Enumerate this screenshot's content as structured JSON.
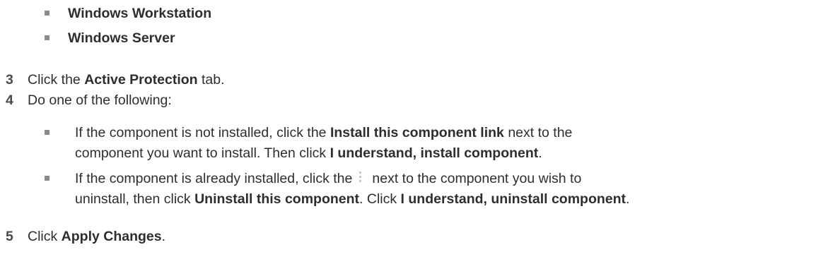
{
  "sub_items": [
    "Windows Workstation",
    "Windows Server"
  ],
  "steps": {
    "step3": {
      "number": "3",
      "pre": "Click the ",
      "bold": "Active Protection",
      "post": " tab."
    },
    "step4": {
      "number": "4",
      "text": "Do one of the following:",
      "options": {
        "a": {
          "line1_pre": "If the component is not installed, click the ",
          "line1_bold": "Install this component link",
          "line1_post": " next to the",
          "line2_pre": "component you want to install. Then click ",
          "line2_bold": "I understand, install component",
          "line2_post": "."
        },
        "b": {
          "line1_pre": "If the component is already installed, click the",
          "icon": "kebab-menu-icon",
          "line1_post": "next to the component you wish to",
          "line2_pre": "uninstall, then click ",
          "line2_bold1": "Uninstall this component",
          "line2_mid": ". Click ",
          "line2_bold2": "I understand, uninstall component",
          "line2_post": "."
        }
      }
    },
    "step5": {
      "number": "5",
      "pre": "Click ",
      "bold": "Apply Changes",
      "post": "."
    }
  }
}
